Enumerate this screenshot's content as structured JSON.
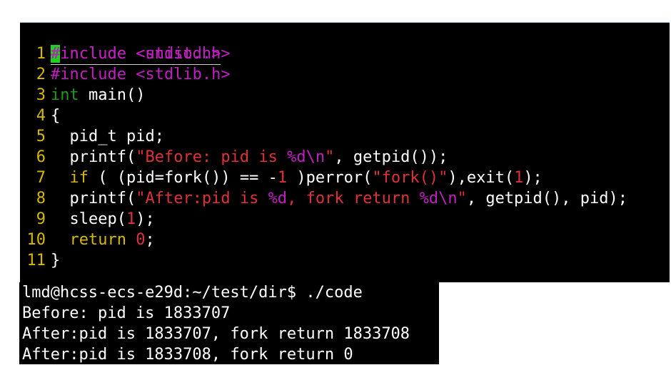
{
  "editor": {
    "header_line": {
      "cursor_char": "#",
      "directive": "include",
      "header": "<stdio.h>"
    },
    "lines": [
      {
        "num": "1",
        "segments": [
          {
            "cls": "pp",
            "text": "#include <unistd.h>"
          }
        ]
      },
      {
        "num": "2",
        "segments": [
          {
            "cls": "pp",
            "text": "#include <stdlib.h>"
          }
        ]
      },
      {
        "num": "3",
        "segments": [
          {
            "cls": "ty",
            "text": "int"
          },
          {
            "cls": "tx",
            "text": " main()"
          }
        ]
      },
      {
        "num": "4",
        "segments": [
          {
            "cls": "tx",
            "text": "{"
          }
        ]
      },
      {
        "num": "5",
        "segments": [
          {
            "cls": "tx",
            "text": "  pid_t pid;"
          }
        ]
      },
      {
        "num": "6",
        "segments": [
          {
            "cls": "tx",
            "text": "  printf("
          },
          {
            "cls": "st",
            "text": "\"Before: pid is "
          },
          {
            "cls": "es",
            "text": "%d\\n"
          },
          {
            "cls": "st",
            "text": "\""
          },
          {
            "cls": "tx",
            "text": ", getpid());"
          }
        ]
      },
      {
        "num": "7",
        "segments": [
          {
            "cls": "tx",
            "text": "  "
          },
          {
            "cls": "kw",
            "text": "if"
          },
          {
            "cls": "tx",
            "text": " ( (pid=fork()) == -"
          },
          {
            "cls": "nu",
            "text": "1"
          },
          {
            "cls": "tx",
            "text": " )perror("
          },
          {
            "cls": "st",
            "text": "\"fork()\""
          },
          {
            "cls": "tx",
            "text": "),exit("
          },
          {
            "cls": "nu",
            "text": "1"
          },
          {
            "cls": "tx",
            "text": ");"
          }
        ]
      },
      {
        "num": "8",
        "segments": [
          {
            "cls": "tx",
            "text": "  printf("
          },
          {
            "cls": "st",
            "text": "\"After:pid is "
          },
          {
            "cls": "es",
            "text": "%d"
          },
          {
            "cls": "st",
            "text": ", fork return "
          },
          {
            "cls": "es",
            "text": "%d\\n"
          },
          {
            "cls": "st",
            "text": "\""
          },
          {
            "cls": "tx",
            "text": ", getpid(), pid);"
          }
        ]
      },
      {
        "num": "9",
        "segments": [
          {
            "cls": "tx",
            "text": "  sleep("
          },
          {
            "cls": "nu",
            "text": "1"
          },
          {
            "cls": "tx",
            "text": ");"
          }
        ]
      },
      {
        "num": "10",
        "segments": [
          {
            "cls": "tx",
            "text": "  "
          },
          {
            "cls": "kw",
            "text": "return"
          },
          {
            "cls": "tx",
            "text": " "
          },
          {
            "cls": "nu",
            "text": "0"
          },
          {
            "cls": "tx",
            "text": ";"
          }
        ]
      },
      {
        "num": "11",
        "segments": [
          {
            "cls": "tx",
            "text": "}"
          }
        ]
      }
    ]
  },
  "terminal": {
    "lines": [
      "lmd@hcss-ecs-e29d:~/test/dir$ ./code",
      "Before: pid is 1833707",
      "After:pid is 1833707, fork return 1833708",
      "After:pid is 1833708, fork return 0"
    ]
  },
  "colors": {
    "background": "#000000",
    "preprocessor": "#c020c0",
    "type": "#1f9a1f",
    "keyword": "#d7b800",
    "string": "#e0303a",
    "line_number": "#d7b800",
    "cursor": "#21d021"
  }
}
